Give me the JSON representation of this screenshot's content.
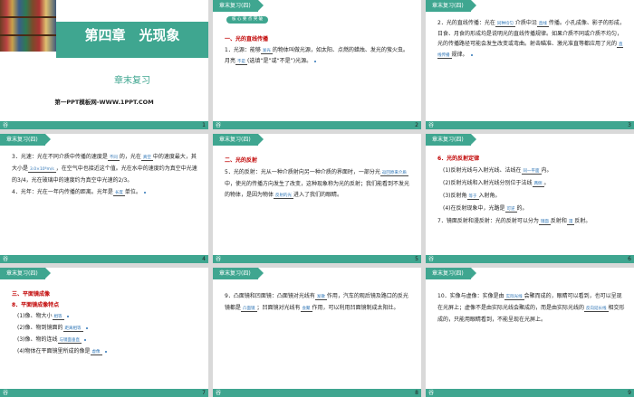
{
  "tag": "章末复习(四)",
  "footer_left": "谷",
  "s1": {
    "title": "第四章　光现象",
    "subtitle": "章末复习",
    "site": "第一PPT模板网-WWW.1PPT.COM",
    "num": "1"
  },
  "s2": {
    "pill": "核 心 要 点 突 破",
    "num": "2",
    "h": "一、光的直线传播",
    "p1": "1．光源：能够",
    "a1": "发光",
    "p2": "的物体叫做光源，如太阳、点燃的蜡烛、发光的萤火虫。月亮",
    "a2": "不是",
    "p3": "(选填“是”或“不是”)光源。"
  },
  "s3": {
    "num": "3",
    "p1": "2．光的直线传播：光在",
    "a1": "同种均匀",
    "p2": "介质中沿",
    "a2": "直线",
    "p3": "传播。小孔成像、影子的形成，日食、月食的形成均是说明光的直线传播规律。如果介质不同或介质不均匀，光的传播路径可能会发生改变或弯曲。射击瞄准、激光准直等都应用了光的",
    "a3": "直线传播",
    "p4": "规律。"
  },
  "s4": {
    "num": "4",
    "p1": "3．光速：光在不同介质中传播的速度是",
    "a1": "不同",
    "p2": "的，光在",
    "a2": "真空",
    "p3": "中的速度最大，其大小是",
    "a3": "3.0×10⁸m/s",
    "p4": "，在空气中也接近这个值。光在水中的速度约为真空中光速的3/4，光在玻璃中的速度约为真空中光速的2/3。",
    "p5": "4．光年：光在一年内传播的距离。光年是",
    "a4": "长度",
    "p6": "单位。"
  },
  "s5": {
    "num": "5",
    "h": "二、光的反射",
    "p1": "5．光的反射：光从一种介质射向另一种介质的界面时，一部分光",
    "a1": "返回原来介质",
    "p2": "中，使光的传播方向发生了改变，这种现象称为光的反射；我们能看到不发光的物体，是因为物体",
    "a2": "反射的光",
    "p3": "进入了我们的眼睛。"
  },
  "s6": {
    "num": "6",
    "h": "6．光的反射定律",
    "l1a": "(1)反射光线与入射光线、法线在",
    "l1b": "同一平面",
    "l1c": "内。",
    "l2a": "(2)反射光线和入射光线分别位于法线",
    "l2b": "两侧",
    "l2c": "。",
    "l3a": "(3)反射角",
    "l3b": "等于",
    "l3c": "入射角。",
    "l4a": "(4)在反射现象中，光路是",
    "l4b": "可逆",
    "l4c": "的。",
    "l5a": "7．镜面反射和漫反射：光的反射可以分为",
    "l5b": "镜面",
    "l5c": "反射和",
    "l5d": "漫",
    "l5e": "反射。"
  },
  "s7": {
    "num": "7",
    "h": "三、平面镜成像",
    "h2": "8．平面镜成像特点",
    "l1a": "(1)像、物大小",
    "l1b": "相等",
    "l2a": "(2)像、物到镜面的",
    "l2b": "距离相等",
    "l3a": "(3)像、物的连线",
    "l3b": "与镜面垂直",
    "l4a": "(4)物体在平面镜里所成的像是",
    "l4b": "虚像"
  },
  "s8": {
    "num": "8",
    "p1": "9．凸面镜和凹面镜：凸面镜对光线有",
    "a1": "发散",
    "p2": "作用，汽车的观后镜及路口的反光镜都是",
    "a2": "凸面镜",
    "p3": "；凹面镜对光线有",
    "a3": "会聚",
    "p4": "作用，可以利用凹面镜制成太阳灶。"
  },
  "s9": {
    "num": "9",
    "p1": "10．实像与虚像：实像是由",
    "a1": "实际光线",
    "p2": "会聚而成的，眼睛可以看到，也可以呈现在光屏上；虚像不是由实际光线会聚成的，而是由实际光线的",
    "a2": "反向延长线",
    "p3": "相交形成的，只能用眼睛看到，不能呈现在光屏上。"
  }
}
